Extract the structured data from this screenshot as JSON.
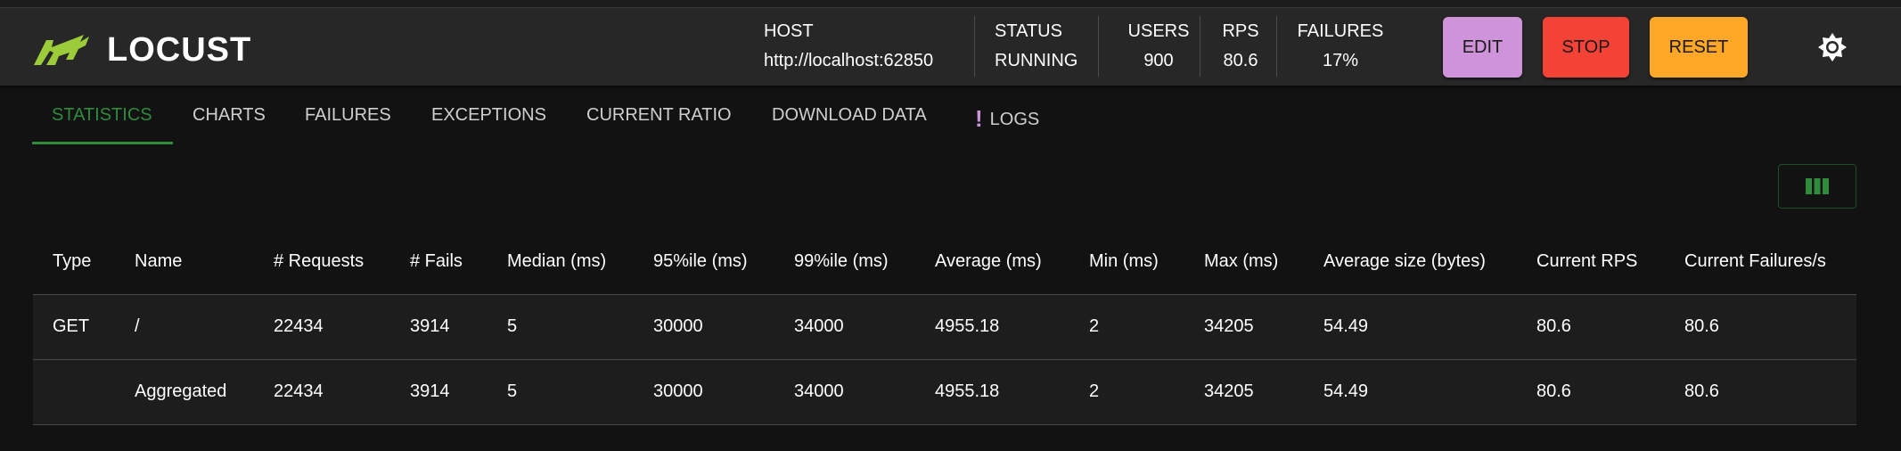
{
  "brand": {
    "name": "LOCUST"
  },
  "stats": {
    "host": {
      "label": "HOST",
      "value": "http://localhost:62850"
    },
    "status": {
      "label": "STATUS",
      "value": "RUNNING"
    },
    "users": {
      "label": "USERS",
      "value": "900"
    },
    "rps": {
      "label": "RPS",
      "value": "80.6"
    },
    "failures": {
      "label": "FAILURES",
      "value": "17%"
    }
  },
  "buttons": {
    "edit": {
      "label": "EDIT",
      "color": "#ce93d8"
    },
    "stop": {
      "label": "STOP",
      "color": "#f44336"
    },
    "reset": {
      "label": "RESET",
      "color": "#ffa726"
    }
  },
  "tabs": [
    {
      "label": "STATISTICS",
      "active": true
    },
    {
      "label": "CHARTS"
    },
    {
      "label": "FAILURES"
    },
    {
      "label": "EXCEPTIONS"
    },
    {
      "label": "CURRENT RATIO"
    },
    {
      "label": "DOWNLOAD DATA"
    },
    {
      "label": "LOGS",
      "icon": "exclamation-icon"
    }
  ],
  "accent": "#2e8b3c",
  "table": {
    "headers": [
      "Type",
      "Name",
      "# Requests",
      "# Fails",
      "Median (ms)",
      "95%ile (ms)",
      "99%ile (ms)",
      "Average (ms)",
      "Min (ms)",
      "Max (ms)",
      "Average size (bytes)",
      "Current RPS",
      "Current Failures/s"
    ],
    "rows": [
      [
        "GET",
        "/",
        "22434",
        "3914",
        "5",
        "30000",
        "34000",
        "4955.18",
        "2",
        "34205",
        "54.49",
        "80.6",
        "80.6"
      ],
      [
        "",
        "Aggregated",
        "22434",
        "3914",
        "5",
        "30000",
        "34000",
        "4955.18",
        "2",
        "34205",
        "54.49",
        "80.6",
        "80.6"
      ]
    ]
  }
}
